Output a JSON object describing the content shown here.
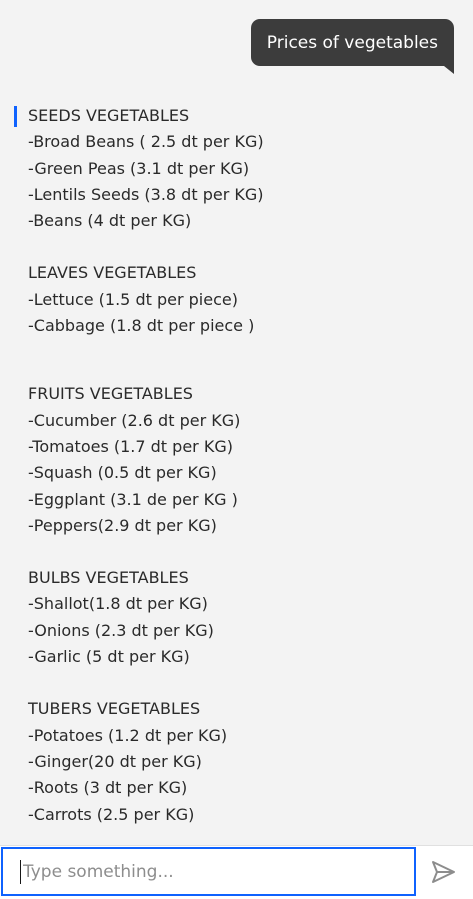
{
  "user_message": "Prices of vegetables",
  "sections": [
    {
      "title": "SEEDS VEGETABLES",
      "items": [
        "-Broad Beans ( 2.5 dt per KG)",
        "-Green Peas (3.1 dt per KG)",
        "-Lentils Seeds (3.8 dt per KG)",
        "-Beans (4 dt per KG)"
      ]
    },
    {
      "title": "LEAVES VEGETABLES",
      "items": [
        "-Lettuce (1.5 dt per piece)",
        "-Cabbage (1.8 dt per piece )"
      ]
    },
    {
      "title": "FRUITS VEGETABLES",
      "items": [
        "-Cucumber (2.6 dt per KG)",
        "-Tomatoes (1.7 dt per KG)",
        "-Squash (0.5 dt per KG)",
        "-Eggplant (3.1 de per KG )",
        "-Peppers(2.9 dt per KG)"
      ]
    },
    {
      "title": "BULBS VEGETABLES",
      "items": [
        "-Shallot(1.8 dt per KG)",
        "-Onions (2.3 dt per KG)",
        "-Garlic (5 dt per KG)"
      ]
    },
    {
      "title": "TUBERS VEGETABLES",
      "items": [
        "-Potatoes (1.2 dt per KG)",
        "-Ginger(20 dt per KG)",
        "-Roots (3 dt per KG)",
        "-Carrots (2.5 per KG)"
      ]
    }
  ],
  "input": {
    "placeholder": "Type something..."
  },
  "icons": {
    "send": "send-icon"
  },
  "colors": {
    "accent": "#0f62fe",
    "user_bubble": "#3c3c3c"
  }
}
